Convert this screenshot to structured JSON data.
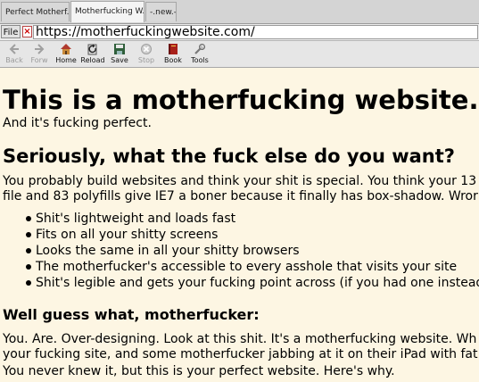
{
  "tabs": [
    {
      "label": "Perfect Motherf..."
    },
    {
      "label": "Motherfucking W..."
    },
    {
      "label": "-.new.-"
    }
  ],
  "urlbar": {
    "file_label": "File",
    "close_glyph": "×",
    "url": "https://motherfuckingwebsite.com/"
  },
  "toolbar": {
    "buttons": [
      {
        "label": "Back",
        "icon": "back-arrow-icon",
        "enabled": false
      },
      {
        "label": "Forw",
        "icon": "forward-arrow-icon",
        "enabled": false
      },
      {
        "label": "Home",
        "icon": "home-icon",
        "enabled": true
      },
      {
        "label": "Reload",
        "icon": "reload-icon",
        "enabled": true
      },
      {
        "label": "Save",
        "icon": "save-icon",
        "enabled": true
      },
      {
        "label": "Stop",
        "icon": "stop-icon",
        "enabled": false
      },
      {
        "label": "Book",
        "icon": "bookmark-icon",
        "enabled": true
      },
      {
        "label": "Tools",
        "icon": "tools-icon",
        "enabled": true
      }
    ]
  },
  "page": {
    "background": "#fdf6e3",
    "title": "This is a motherfucking website.",
    "subtitle": "And it's fucking perfect.",
    "heading2": "Seriously, what the fuck else do you want?",
    "para1_line1": "You probably build websites and think your shit is special. You think your 13",
    "para1_line2": "file and 83 polyfills give IE7 a boner because it finally has box-shadow. Wror",
    "bullets": [
      "Shit's lightweight and loads fast",
      "Fits on all your shitty screens",
      "Looks the same in all your shitty browsers",
      "The motherfucker's accessible to every asshole that visits your site",
      "Shit's legible and gets your fucking point across (if you had one instead"
    ],
    "heading3": "Well guess what, motherfucker:",
    "para2_line1": "You. Are. Over-designing. Look at this shit. It's a motherfucking website. Wh",
    "para2_line2": "your fucking site, and some motherfucker jabbing at it on their iPad with fat",
    "para3": "You never knew it, but this is your perfect website. Here's why."
  }
}
